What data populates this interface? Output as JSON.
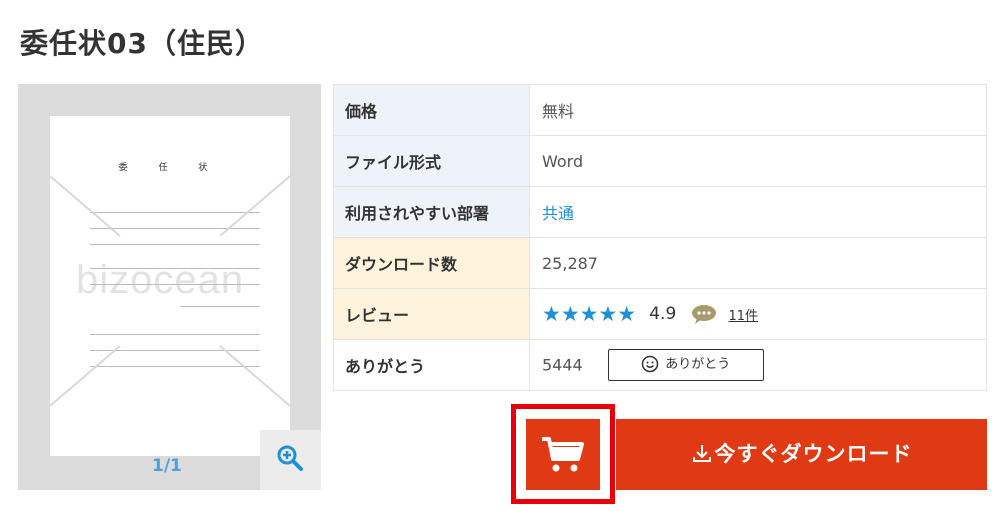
{
  "page": {
    "title": "委任状03（住民）"
  },
  "preview": {
    "doc_title": "委 任 状",
    "watermark": "bizocean",
    "page_counter": "1/1",
    "zoom_icon": "zoom-in-icon"
  },
  "info": {
    "rows": [
      {
        "label": "価格",
        "value": "無料"
      },
      {
        "label": "ファイル形式",
        "value": "Word"
      },
      {
        "label": "利用されやすい部署",
        "value": "共通"
      },
      {
        "label": "ダウンロード数",
        "value": "25,287"
      },
      {
        "label": "レビュー",
        "stars": "★★★★★",
        "rating": "4.9",
        "review_count": "11件"
      },
      {
        "label": "ありがとう",
        "value": "5444",
        "button": "ありがとう"
      }
    ]
  },
  "actions": {
    "cart_icon": "cart-icon",
    "download_label": "今すぐダウンロード",
    "accent": "#e03a14",
    "highlight": "#e8000a"
  }
}
